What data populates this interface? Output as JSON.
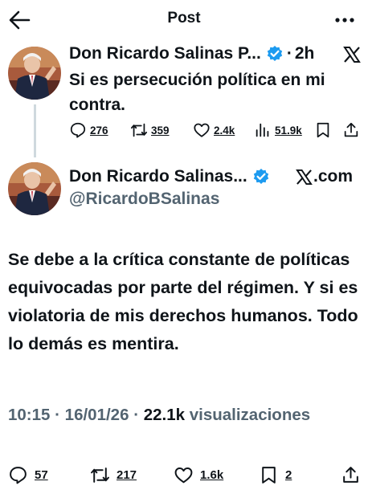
{
  "header": {
    "title": "Post",
    "back_icon": "arrow-left-icon",
    "more_icon": "more-horizontal-icon"
  },
  "reply": {
    "author_name": "Don Ricardo Salinas P...",
    "time_separator": "·",
    "time_ago": "2h",
    "text": "Si es persecución política en mi contra.",
    "stats": {
      "replies": "276",
      "reposts": "359",
      "likes": "2.4k",
      "views": "51.9k"
    }
  },
  "post": {
    "author_name": "Don Ricardo Salinas...",
    "handle": "@RicardoBSalinas",
    "source": ".com",
    "text": "Se debe a la crítica constante de políticas equivocadas por parte del régimen. Y si es violatoria de mis derechos humanos. Todo lo demás es mentira.",
    "time": "10:15",
    "separator": "·",
    "date": "16/01/26",
    "views_count": "22.1k",
    "views_label": "visualizaciones",
    "stats": {
      "replies": "57",
      "reposts": "217",
      "likes": "1.6k",
      "bookmarks": "2"
    }
  },
  "colors": {
    "text": "#0f1419",
    "secondary": "#536471",
    "verified_blue": "#1d9bf0",
    "thread_line": "#cfd9de"
  }
}
